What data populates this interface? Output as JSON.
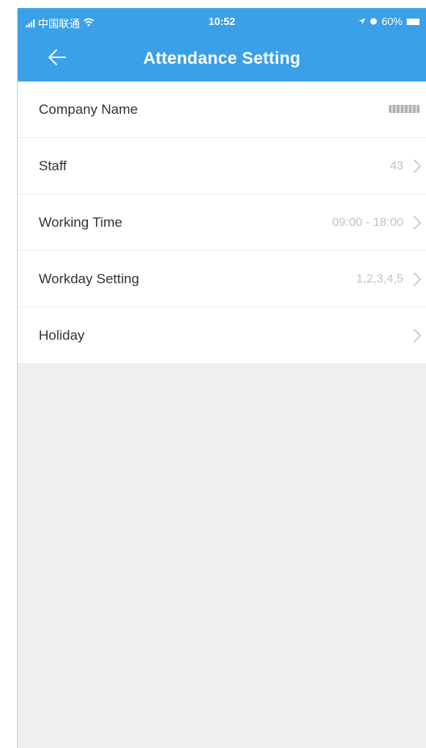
{
  "status_bar": {
    "carrier": "中国联通",
    "time": "10:52",
    "battery": "60%"
  },
  "nav": {
    "title": "Attendance Setting",
    "back_icon": "arrow-left-icon"
  },
  "colors": {
    "header": "#3aa0e8",
    "background": "#efefef",
    "row_value": "#c2c2c2"
  },
  "rows": [
    {
      "label": "Company Name",
      "value": "",
      "chevron": false
    },
    {
      "label": "Staff",
      "value": "43",
      "chevron": true
    },
    {
      "label": "Working Time",
      "value": "09:00 - 18:00",
      "chevron": true
    },
    {
      "label": "Workday Setting",
      "value": "1,2,3,4,5",
      "chevron": true
    },
    {
      "label": "Holiday",
      "value": "",
      "chevron": true
    }
  ]
}
